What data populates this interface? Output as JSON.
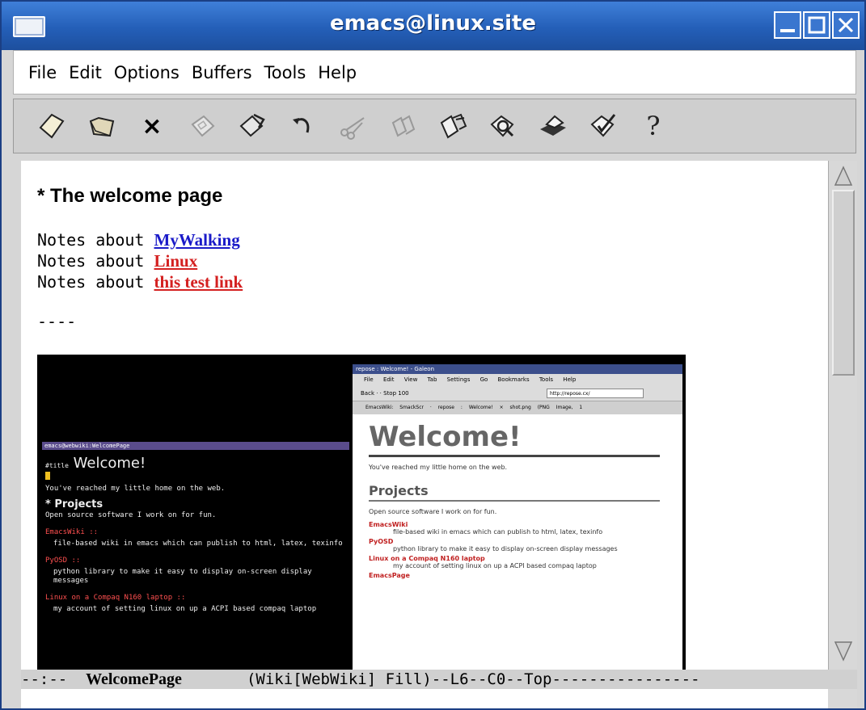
{
  "window": {
    "title": "emacs@linux.site"
  },
  "menu": [
    "File",
    "Edit",
    "Options",
    "Buffers",
    "Tools",
    "Help"
  ],
  "toolbar": {
    "icons": [
      "new-file-icon",
      "open-folder-icon",
      "close-x-icon",
      "save-disk-icon",
      "save-as-icon",
      "undo-icon",
      "cut-scissors-icon",
      "copy-icon",
      "paste-icon",
      "search-icon",
      "print-icon",
      "spell-check-icon",
      "help-icon"
    ],
    "close_glyph": "×",
    "help_glyph": "?"
  },
  "editor": {
    "heading": "* The welcome page",
    "notes": [
      {
        "prefix": "Notes about ",
        "link": "MyWalking",
        "color": "#1a1ac8"
      },
      {
        "prefix": "Notes about ",
        "link": "Linux",
        "color": "#d42020"
      },
      {
        "prefix": "Notes about ",
        "link": "this test link",
        "color": "#d42020"
      }
    ],
    "rule": "----"
  },
  "screenshot": {
    "term": {
      "titlebar": "emacs@webwiki:WelcomePage",
      "title_prefix": "#title",
      "title": "Welcome!",
      "intro": "You've reached my little home on the web.",
      "projects": "* Projects",
      "projects_desc": "Open source software I work on for fun.",
      "items": [
        {
          "name": "EmacsWiki",
          "suffix": " ::",
          "desc": "file-based wiki in emacs which can publish to html, latex, texinfo"
        },
        {
          "name": "PyOSD",
          "suffix": " ::",
          "desc": "python library to make it easy to display on-screen display messages"
        },
        {
          "name": "Linux on a Compaq N160 laptop",
          "suffix": " ::",
          "desc": "my account of setting linux on up a ACPI based compaq laptop"
        }
      ]
    },
    "galeon": {
      "titlebar": "repose : Welcome! - Galeon",
      "menu": "File Edit View Tab Settings Go Bookmarks Tools Help",
      "nav": "Back · · Stop 100",
      "url": "http://repose.cx/",
      "tabs": "EmacsWiki: SmackScr · repose : Welcome! × shot.png (PNG Image, 1",
      "title": "Welcome!",
      "intro": "You've reached my little home on the web.",
      "projects": "Projects",
      "projects_desc": "Open source software I work on for fun.",
      "items": [
        {
          "name": "EmacsWiki",
          "desc": "file-based wiki in emacs which can publish to html, latex, texinfo"
        },
        {
          "name": "PyOSD",
          "desc": "python library to make it easy to display on-screen display messages"
        },
        {
          "name": "Linux on a Compaq N160 laptop",
          "desc": "my account of setting linux on up a ACPI based compaq laptop"
        },
        {
          "name": "EmacsPage",
          "desc": ""
        }
      ]
    }
  },
  "modeline": {
    "prefix": "--:--  ",
    "buffer": "WelcomePage",
    "suffix": "       (Wiki[WebWiki] Fill)--L6--C0--Top----------------"
  }
}
